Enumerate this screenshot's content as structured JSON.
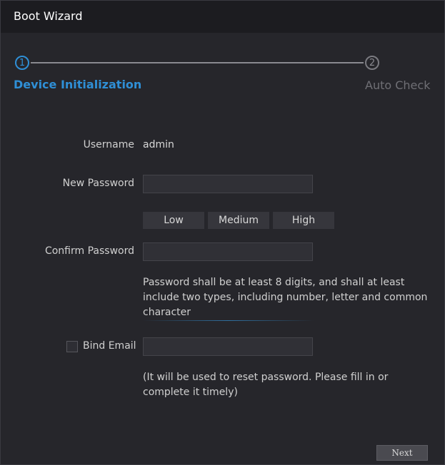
{
  "window": {
    "title": "Boot Wizard"
  },
  "stepper": {
    "steps": [
      {
        "number": "1",
        "label": "Device Initialization",
        "state": "active"
      },
      {
        "number": "2",
        "label": "Auto Check",
        "state": "inactive"
      }
    ],
    "colors": {
      "active": "#2f8fd6",
      "inactive": "#8a8a90"
    }
  },
  "form": {
    "username_label": "Username",
    "username_value": "admin",
    "new_password_label": "New Password",
    "new_password_value": "",
    "strength": {
      "low": "Low",
      "medium": "Medium",
      "high": "High"
    },
    "confirm_password_label": "Confirm Password",
    "confirm_password_value": "",
    "password_hint": "Password shall be at least 8 digits, and shall at least include two types, including number, letter and common character",
    "bind_email_label": "Bind Email",
    "bind_email_checked": false,
    "email_value": "",
    "email_hint": "(It will be used to reset password. Please fill in or complete it timely)"
  },
  "footer": {
    "next_label": "Next"
  }
}
